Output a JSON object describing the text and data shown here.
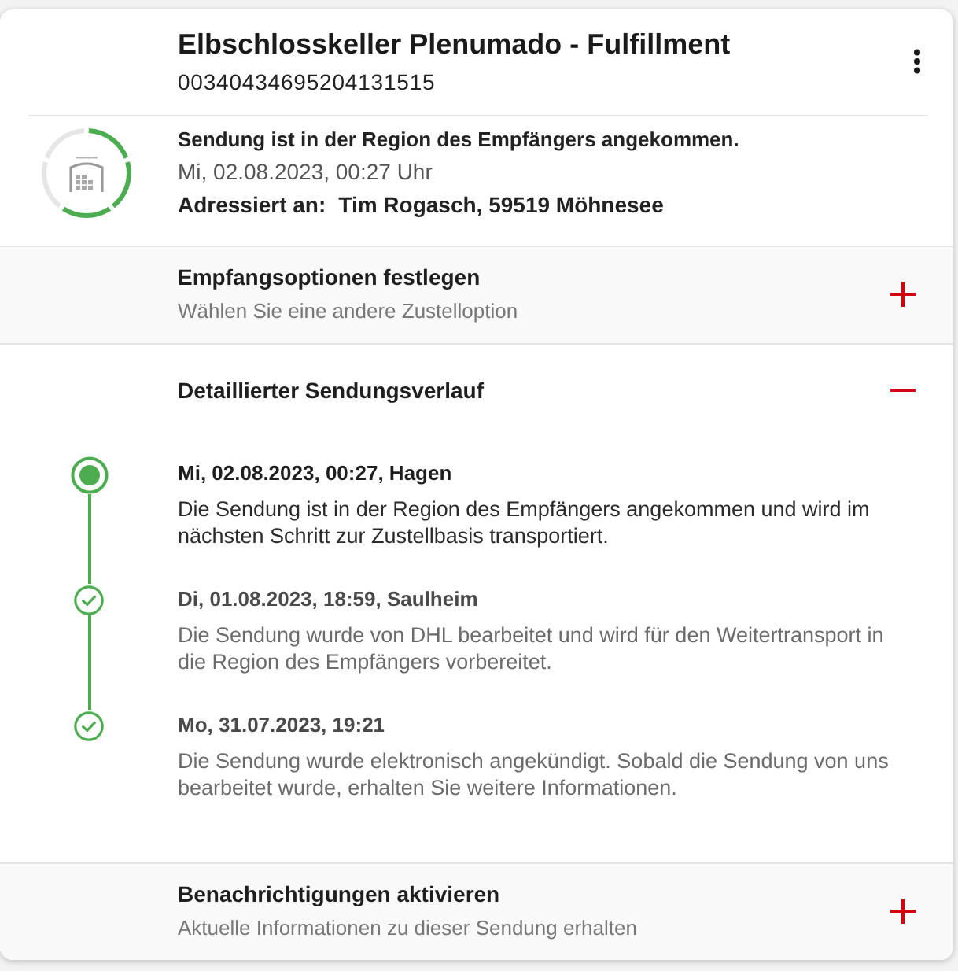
{
  "header": {
    "title": "Elbschlosskeller Plenumado - Fulfillment",
    "tracking_number": "00340434695204131515"
  },
  "status": {
    "level": 0.6,
    "headline": "Sendung ist in der Region des Empfängers angekommen.",
    "date": "Mi, 02.08.2023, 00:27 Uhr",
    "address_label": "Adressiert an:",
    "address": "Tim Rogasch, 59519 Möhnesee"
  },
  "sections": [
    {
      "title": "Empfangsoptionen festlegen",
      "subtitle": "Wählen Sie eine andere Zustelloption",
      "expanded": false
    },
    {
      "title": "Detaillierter Sendungsverlauf",
      "expanded": true,
      "events": [
        {
          "date": "Mi, 02.08.2023, 00:27, Hagen",
          "text": "Die Sendung ist in der Region des Empfängers angekommen und wird im nächsten Schritt zur Zustellbasis transportiert.",
          "current": true
        },
        {
          "date": "Di, 01.08.2023, 18:59, Saulheim",
          "text": "Die Sendung wurde von DHL bearbeitet und wird für den Weitertransport in die Region des Empfängers vorbereitet.",
          "current": false
        },
        {
          "date": "Mo, 31.07.2023, 19:21",
          "text": "Die Sendung wurde elektronisch angekündigt. Sobald die Sendung von uns bearbeitet wurde, erhalten Sie weitere Informationen.",
          "current": false
        }
      ]
    },
    {
      "title": "Benachrichtigungen aktivieren",
      "subtitle": "Aktuelle Informationen zu dieser Sendung erhalten",
      "expanded": false
    }
  ]
}
